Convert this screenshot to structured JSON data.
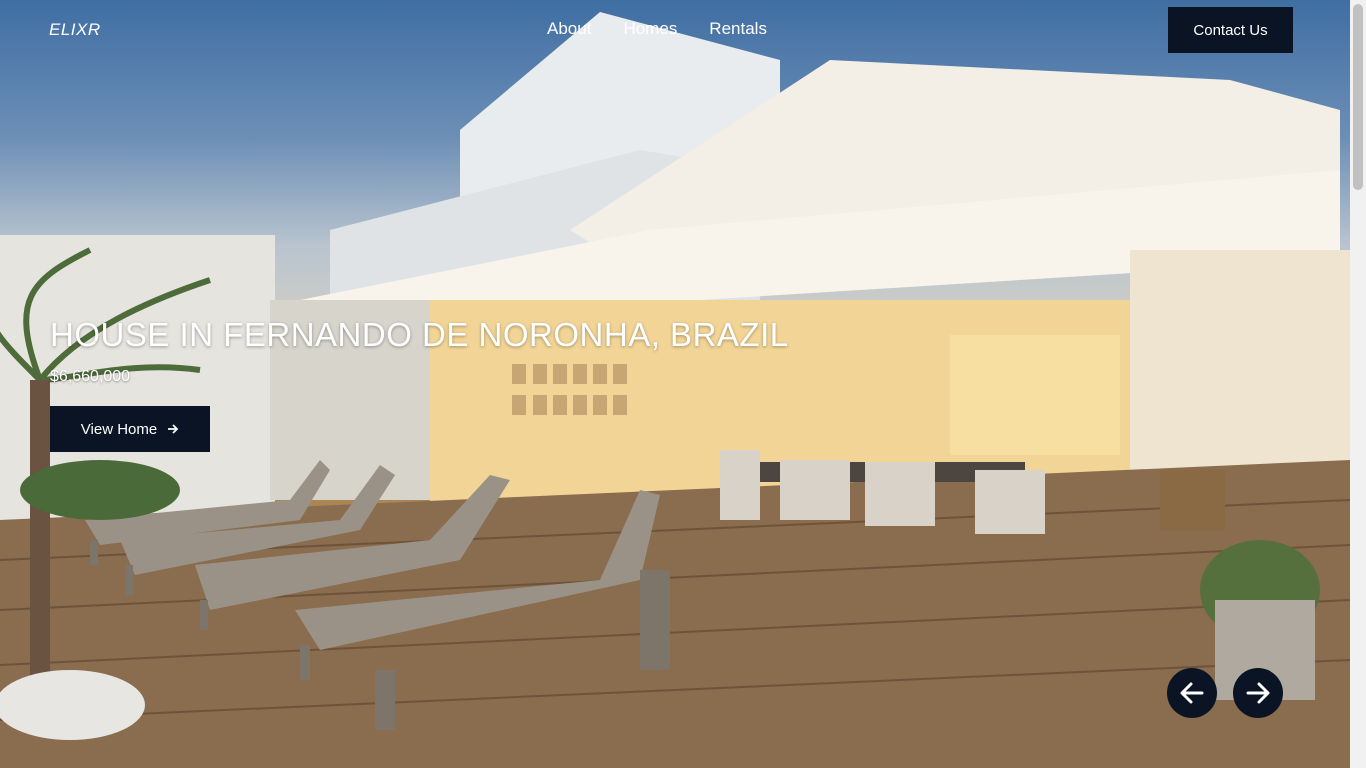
{
  "brand": {
    "logo": "ELIXR"
  },
  "nav": {
    "items": [
      "About",
      "Homes",
      "Rentals"
    ]
  },
  "header": {
    "contact_label": "Contact Us"
  },
  "hero": {
    "title": "HOUSE IN FERNANDO DE NORONHA, BRAZIL",
    "price": "$6,660,000",
    "cta_label": "View Home"
  },
  "carousel": {
    "prev_icon": "arrow-left-icon",
    "next_icon": "arrow-right-icon"
  },
  "colors": {
    "dark_navy": "#0b1424",
    "text": "#ffffff"
  }
}
